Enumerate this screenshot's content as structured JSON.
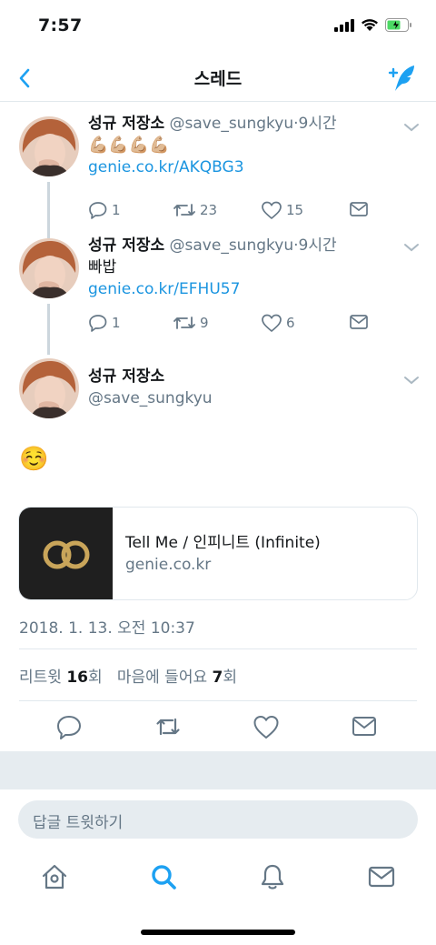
{
  "status": {
    "time": "7:57"
  },
  "nav": {
    "title": "스레드"
  },
  "tweets": [
    {
      "name": "성규 저장소",
      "handle": "@save_sungkyu",
      "sep": "·",
      "time": "9시간",
      "text": "💪🏼💪🏼💪🏼💪🏼",
      "link": "genie.co.kr/AKQBG3",
      "replies": "1",
      "retweets": "23",
      "likes": "15"
    },
    {
      "name": "성규 저장소",
      "handle": "@save_sungkyu",
      "sep": "·",
      "time": "9시간",
      "text": "빠밥",
      "link": "genie.co.kr/EFHU57",
      "replies": "1",
      "retweets": "9",
      "likes": "6"
    }
  ],
  "focus": {
    "name": "성규 저장소",
    "handle": "@save_sungkyu",
    "text": "☺️",
    "card": {
      "title": "Tell Me / 인피니트 (Infinite)",
      "domain": "genie.co.kr"
    },
    "timestamp": "2018. 1. 13. 오전 10:37",
    "retweet_label": "리트윗 ",
    "retweet_count": "16",
    "retweet_unit": "회",
    "like_label": "마음에 들어요 ",
    "like_count": "7",
    "like_unit": "회"
  },
  "reply": {
    "placeholder": "답글 트윗하기"
  },
  "colors": {
    "accent": "#1da1f2",
    "link": "#1b95e0",
    "muted": "#657786",
    "border": "#e1e8ed",
    "card_gold": "#c9a55a"
  },
  "icons": [
    "back-icon",
    "compose-icon",
    "reply-icon",
    "retweet-icon",
    "like-icon",
    "dm-icon",
    "caret-down-icon",
    "home-icon",
    "search-icon",
    "notifications-icon",
    "messages-icon"
  ]
}
